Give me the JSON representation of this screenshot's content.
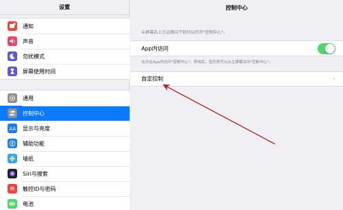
{
  "sidebar": {
    "title": "设置",
    "group1": [
      {
        "name": "notifications",
        "label": "通知",
        "icon": "notifications-icon",
        "color": "#f0443a"
      },
      {
        "name": "sounds",
        "label": "声音",
        "icon": "speaker-icon",
        "color": "#f2416a"
      },
      {
        "name": "do-not-disturb",
        "label": "勿扰模式",
        "icon": "moon-icon",
        "color": "#5e57d6"
      },
      {
        "name": "screen-time",
        "label": "屏幕使用时间",
        "icon": "hourglass-icon",
        "color": "#5e57d6"
      }
    ],
    "group2": [
      {
        "name": "general",
        "label": "通用",
        "icon": "gear-icon",
        "color": "#8e8e93"
      },
      {
        "name": "control-center",
        "label": "控制中心",
        "icon": "switches-icon",
        "color": "#8e8e93",
        "selected": true
      },
      {
        "name": "display",
        "label": "显示与亮度",
        "icon": "text-size-icon",
        "color": "#1f7cf0"
      },
      {
        "name": "accessibility",
        "label": "辅助功能",
        "icon": "accessibility-icon",
        "color": "#1f7cf0"
      },
      {
        "name": "wallpaper",
        "label": "墙纸",
        "icon": "flower-icon",
        "color": "#35aadc"
      },
      {
        "name": "siri",
        "label": "Siri与搜索",
        "icon": "siri-icon",
        "color": "#222222"
      },
      {
        "name": "touch-id",
        "label": "触控ID与密码",
        "icon": "fingerprint-icon",
        "color": "#f0443a"
      },
      {
        "name": "battery",
        "label": "电池",
        "icon": "battery-icon",
        "color": "#4cd964"
      }
    ]
  },
  "main": {
    "title": "控制中心",
    "hint": "从屏幕右上方边缘向下轻扫以打开\"控制中心\"。",
    "access_label": "App内访问",
    "access_enabled": true,
    "access_desc": "允许在App内访问\"控制中心\"。停用后，您仍然可以从主屏幕访问\"控制中心\"。",
    "customize_label": "自定控制"
  },
  "colors": {
    "accent": "#0a7aff",
    "toggle_on": "#4cd964",
    "annotation_arrow": "#b3221b"
  }
}
